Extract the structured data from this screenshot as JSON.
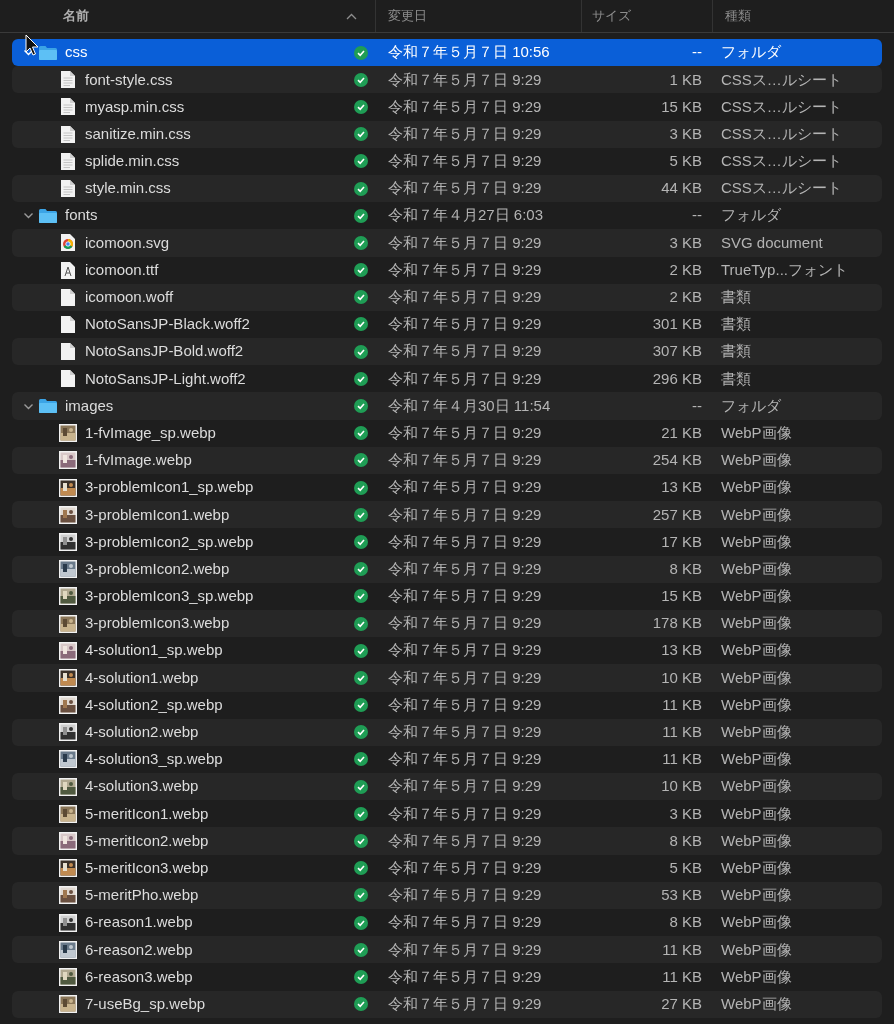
{
  "columns": [
    {
      "label": "名前",
      "sorted": true
    },
    {
      "label": "変更日",
      "sorted": false
    },
    {
      "label": "サイズ",
      "sorted": false
    },
    {
      "label": "種類",
      "sorted": false
    }
  ],
  "items": [
    {
      "name": "css",
      "kind": "folder",
      "modified": "令和７年５月７日 10:56",
      "size": "--",
      "type": "フォルダ",
      "selected": true,
      "expanded": true,
      "children": [
        {
          "name": "font-style.css",
          "kind": "document",
          "modified": "令和７年５月７日 9:29",
          "size": "1 KB",
          "type": "CSSス…ルシート",
          "selected": false
        },
        {
          "name": "myasp.min.css",
          "kind": "document",
          "modified": "令和７年５月７日 9:29",
          "size": "15 KB",
          "type": "CSSス…ルシート",
          "selected": false
        },
        {
          "name": "sanitize.min.css",
          "kind": "document",
          "modified": "令和７年５月７日 9:29",
          "size": "3 KB",
          "type": "CSSス…ルシート",
          "selected": false
        },
        {
          "name": "splide.min.css",
          "kind": "document",
          "modified": "令和７年５月７日 9:29",
          "size": "5 KB",
          "type": "CSSス…ルシート",
          "selected": false
        },
        {
          "name": "style.min.css",
          "kind": "document",
          "modified": "令和７年５月７日 9:29",
          "size": "44 KB",
          "type": "CSSス…ルシート",
          "selected": false
        }
      ]
    },
    {
      "name": "fonts",
      "kind": "folder",
      "modified": "令和７年４月27日 6:03",
      "size": "--",
      "type": "フォルダ",
      "selected": false,
      "expanded": true,
      "children": [
        {
          "name": "icomoon.svg",
          "kind": "browser",
          "modified": "令和７年５月７日 9:29",
          "size": "3 KB",
          "type": "SVG document",
          "selected": false
        },
        {
          "name": "icomoon.ttf",
          "kind": "font",
          "modified": "令和７年５月７日 9:29",
          "size": "2 KB",
          "type": "TrueTyp...フォント",
          "selected": false
        },
        {
          "name": "icomoon.woff",
          "kind": "blank",
          "modified": "令和７年５月７日 9:29",
          "size": "2 KB",
          "type": "書類",
          "selected": false
        },
        {
          "name": "NotoSansJP-Black.woff2",
          "kind": "blank",
          "modified": "令和７年５月７日 9:29",
          "size": "301 KB",
          "type": "書類",
          "selected": false
        },
        {
          "name": "NotoSansJP-Bold.woff2",
          "kind": "blank",
          "modified": "令和７年５月７日 9:29",
          "size": "307 KB",
          "type": "書類",
          "selected": false
        },
        {
          "name": "NotoSansJP-Light.woff2",
          "kind": "blank",
          "modified": "令和７年５月７日 9:29",
          "size": "296 KB",
          "type": "書類",
          "selected": false
        }
      ]
    },
    {
      "name": "images",
      "kind": "folder",
      "modified": "令和７年４月30日 11:54",
      "size": "--",
      "type": "フォルダ",
      "selected": false,
      "expanded": true,
      "children": [
        {
          "name": "1-fvImage_sp.webp",
          "modified": "令和７年５月７日 9:29",
          "size": "21 KB",
          "type": "WebP画像",
          "selected": false
        },
        {
          "name": "1-fvImage.webp",
          "modified": "令和７年５月７日 9:29",
          "size": "254 KB",
          "type": "WebP画像",
          "selected": false
        },
        {
          "name": "3-problemIcon1_sp.webp",
          "modified": "令和７年５月７日 9:29",
          "size": "13 KB",
          "type": "WebP画像",
          "selected": false
        },
        {
          "name": "3-problemIcon1.webp",
          "modified": "令和７年５月７日 9:29",
          "size": "257 KB",
          "type": "WebP画像",
          "selected": false
        },
        {
          "name": "3-problemIcon2_sp.webp",
          "modified": "令和７年５月７日 9:29",
          "size": "17 KB",
          "type": "WebP画像",
          "selected": false
        },
        {
          "name": "3-problemIcon2.webp",
          "modified": "令和７年５月７日 9:29",
          "size": "8 KB",
          "type": "WebP画像",
          "selected": false
        },
        {
          "name": "3-problemIcon3_sp.webp",
          "modified": "令和７年５月７日 9:29",
          "size": "15 KB",
          "type": "WebP画像",
          "selected": false
        },
        {
          "name": "3-problemIcon3.webp",
          "modified": "令和７年５月７日 9:29",
          "size": "178 KB",
          "type": "WebP画像",
          "selected": false
        },
        {
          "name": "4-solution1_sp.webp",
          "modified": "令和７年５月７日 9:29",
          "size": "13 KB",
          "type": "WebP画像",
          "selected": false
        },
        {
          "name": "4-solution1.webp",
          "modified": "令和７年５月７日 9:29",
          "size": "10 KB",
          "type": "WebP画像",
          "selected": false
        },
        {
          "name": "4-solution2_sp.webp",
          "modified": "令和７年５月７日 9:29",
          "size": "11 KB",
          "type": "WebP画像",
          "selected": false
        },
        {
          "name": "4-solution2.webp",
          "modified": "令和７年５月７日 9:29",
          "size": "11 KB",
          "type": "WebP画像",
          "selected": false
        },
        {
          "name": "4-solution3_sp.webp",
          "modified": "令和７年５月７日 9:29",
          "size": "11 KB",
          "type": "WebP画像",
          "selected": false
        },
        {
          "name": "4-solution3.webp",
          "modified": "令和７年５月７日 9:29",
          "size": "10 KB",
          "type": "WebP画像",
          "selected": false
        },
        {
          "name": "5-meritIcon1.webp",
          "modified": "令和７年５月７日 9:29",
          "size": "3 KB",
          "type": "WebP画像",
          "selected": false
        },
        {
          "name": "5-meritIcon2.webp",
          "modified": "令和７年５月７日 9:29",
          "size": "8 KB",
          "type": "WebP画像",
          "selected": false
        },
        {
          "name": "5-meritIcon3.webp",
          "modified": "令和７年５月７日 9:29",
          "size": "5 KB",
          "type": "WebP画像",
          "selected": false
        },
        {
          "name": "5-meritPho.webp",
          "modified": "令和７年５月７日 9:29",
          "size": "53 KB",
          "type": "WebP画像",
          "selected": false
        },
        {
          "name": "6-reason1.webp",
          "modified": "令和７年５月７日 9:29",
          "size": "8 KB",
          "type": "WebP画像",
          "selected": false
        },
        {
          "name": "6-reason2.webp",
          "modified": "令和７年５月７日 9:29",
          "size": "11 KB",
          "type": "WebP画像",
          "selected": false
        },
        {
          "name": "6-reason3.webp",
          "modified": "令和７年５月７日 9:29",
          "size": "11 KB",
          "type": "WebP画像",
          "selected": false
        },
        {
          "name": "7-useBg_sp.webp",
          "modified": "令和７年５月７日 9:29",
          "size": "27 KB",
          "type": "WebP画像",
          "selected": false
        }
      ]
    }
  ]
}
